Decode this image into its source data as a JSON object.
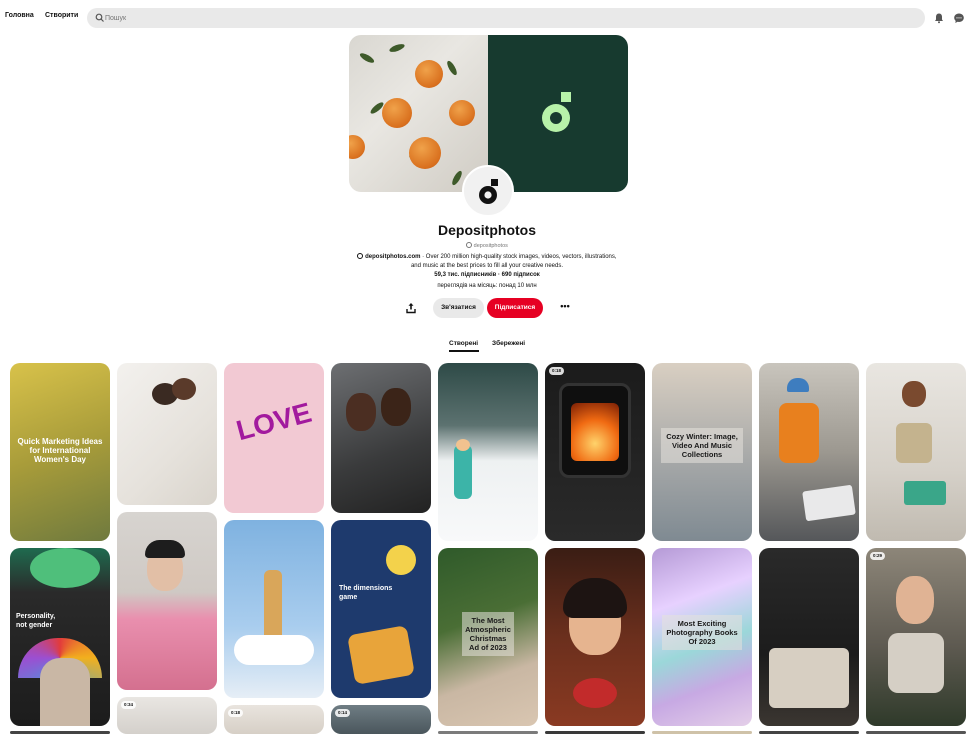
{
  "topbar": {
    "home": "Головна",
    "create": "Створити",
    "search_placeholder": "Пошук",
    "icons": [
      "search-icon",
      "bell-icon",
      "messages-icon"
    ]
  },
  "profile": {
    "name": "Depositphotos",
    "handle": "depositphotos",
    "website": "depositphotos.com",
    "about": "Over 200 million high-quality stock images, videos, vectors, illustrations, and music at the best prices to fill all your creative needs.",
    "stats": "59,3 тис. підписників · 690 підписок",
    "views": "переглядів на місяць: понад 10 млн",
    "brand_color": "#173a2f"
  },
  "actions": {
    "contact": "Зв'язатися",
    "subscribe": "Підписатися",
    "more": "•••"
  },
  "tabs": {
    "created": "Створені",
    "saved": "Збережені"
  },
  "pins": {
    "p1": "Quick Marketing Ideas for International Women's Day",
    "p2": "Cozy Winter: Image, Video And Music Collections",
    "p3": "The Most Atmospheric Christmas Ad of 2023",
    "p4": "Most Exciting Photography Books Of 2023",
    "p5": "Personality, not gender",
    "p6": "The dimensions game",
    "p7": "LOVE",
    "d1": "0:18",
    "d2": "0:29",
    "d3": "0:34",
    "d4": "0:18",
    "d5": "0:14"
  }
}
